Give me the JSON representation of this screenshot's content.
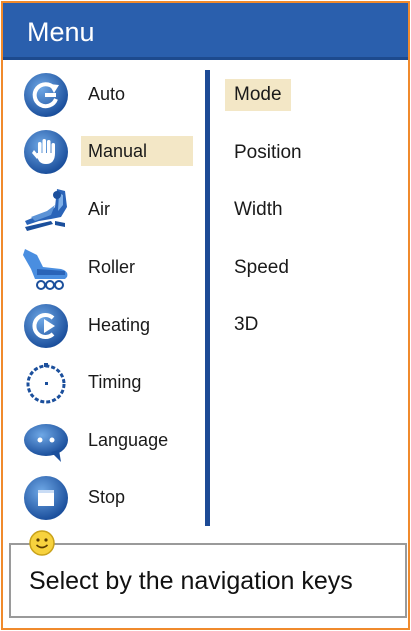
{
  "window": {
    "title": "Menu"
  },
  "menu": {
    "items": [
      {
        "label": "Auto",
        "icon": "auto-cycle-icon"
      },
      {
        "label": "Manual",
        "icon": "hand-icon",
        "selected": true
      },
      {
        "label": "Air",
        "icon": "massage-chair-icon"
      },
      {
        "label": "Roller",
        "icon": "foot-roller-icon"
      },
      {
        "label": "Heating",
        "icon": "heating-icon"
      },
      {
        "label": "Timing",
        "icon": "timer-icon"
      },
      {
        "label": "Language",
        "icon": "speech-bubble-icon"
      },
      {
        "label": "Stop",
        "icon": "stop-icon"
      }
    ]
  },
  "submenu": {
    "items": [
      {
        "label": "Mode",
        "selected": true
      },
      {
        "label": "Position"
      },
      {
        "label": "Width"
      },
      {
        "label": "Speed"
      },
      {
        "label": "3D"
      }
    ]
  },
  "status": {
    "hint": "Select by the navigation keys",
    "icon": "smiley-icon"
  },
  "colors": {
    "border": "#f08a2c",
    "titlebar": "#2a5fad",
    "highlight": "#f3e7c6",
    "divider": "#1d4a95"
  }
}
